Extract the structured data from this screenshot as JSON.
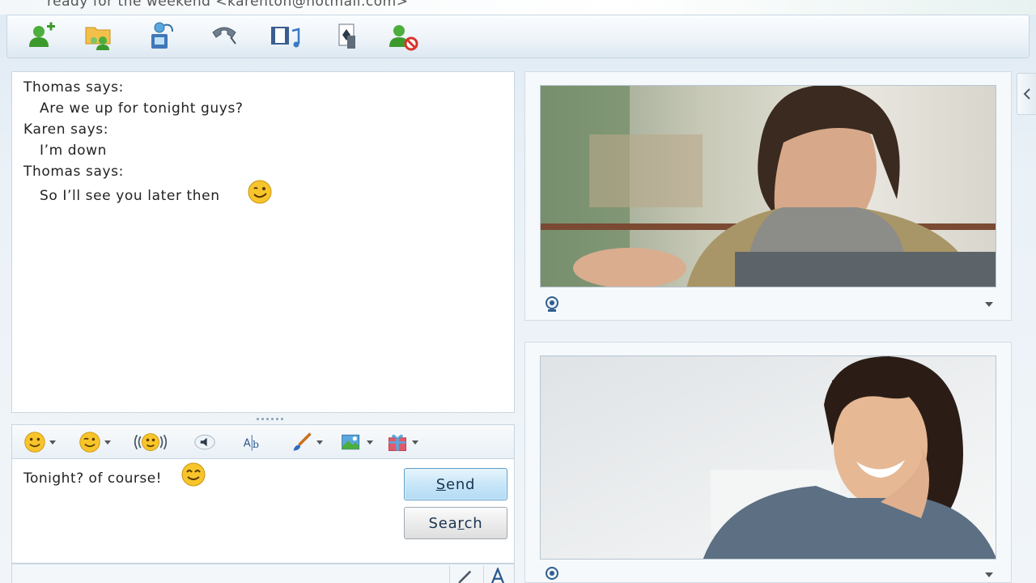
{
  "window": {
    "status_line": "ready for the weekend <karenton@hotmail.com>"
  },
  "toolbar": {
    "items": [
      {
        "name": "invite-contact",
        "icon": "add-contact-icon"
      },
      {
        "name": "send-files",
        "icon": "shared-folder-icon"
      },
      {
        "name": "video-call",
        "icon": "video-call-icon"
      },
      {
        "name": "call",
        "icon": "phone-icon"
      },
      {
        "name": "activities",
        "icon": "media-music-icon"
      },
      {
        "name": "games",
        "icon": "games-card-icon"
      },
      {
        "name": "block",
        "icon": "block-contact-icon"
      }
    ]
  },
  "chat": {
    "messages": [
      {
        "speaker_line": "Thomas says:",
        "text": "Are we up for tonight guys?",
        "emoji": ""
      },
      {
        "speaker_line": "Karen says:",
        "text": "I’m down",
        "emoji": ""
      },
      {
        "speaker_line": "Thomas says:",
        "text": "So I’ll see you later then",
        "emoji": "wink-emoticon"
      }
    ]
  },
  "format_bar": {
    "items": [
      {
        "name": "emoticons",
        "icon": "smiley-icon",
        "has_dropdown": true
      },
      {
        "name": "winks",
        "icon": "wink-icon",
        "has_dropdown": true
      },
      {
        "name": "nudge",
        "icon": "nudge-icon",
        "has_dropdown": false
      },
      {
        "name": "voice-clip",
        "icon": "speaker-icon",
        "has_dropdown": false
      },
      {
        "name": "font",
        "icon": "font-style-icon",
        "has_dropdown": false
      },
      {
        "name": "ink",
        "icon": "brush-icon",
        "has_dropdown": true
      },
      {
        "name": "background",
        "icon": "background-image-icon",
        "has_dropdown": true
      },
      {
        "name": "gift",
        "icon": "gift-icon",
        "has_dropdown": true
      }
    ]
  },
  "compose": {
    "text": "Tonight? of course!",
    "emoji": "smile-emoticon"
  },
  "buttons": {
    "send_prefix": "",
    "send_underlined": "S",
    "send_rest": "end",
    "search_prefix": "Sea",
    "search_underlined": "r",
    "search_rest": "ch"
  },
  "colors": {
    "accent": "#5d9dc9",
    "emoticon_yellow": "#f7c52b"
  }
}
